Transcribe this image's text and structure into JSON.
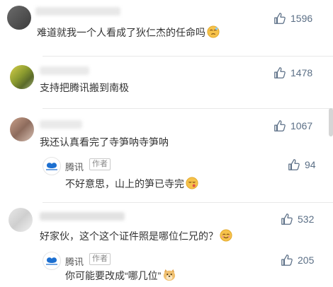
{
  "colors": {
    "like_icon": "#5b6f86",
    "text": "#333333",
    "tencent_blue": "#1c6fd0"
  },
  "comments": [
    {
      "text": "难道就我一个人看成了狄仁杰的任命吗",
      "likes": "1596",
      "emoji": "sleepy-face-icon"
    },
    {
      "text": "支持把腾讯搬到南极",
      "likes": "1478"
    },
    {
      "text": "我还认真看完了寺笋呐寺笋呐",
      "likes": "1067",
      "reply": {
        "author": "腾讯",
        "tag": "作者",
        "text": "不好意思，山上的笋已寺完",
        "likes": "94",
        "emoji": "relieved-face-icon"
      }
    },
    {
      "text": "好家伙，这个这个证件照是哪位仁兄的？",
      "likes": "532",
      "emoji": "smiling-face-icon",
      "reply": {
        "author": "腾讯",
        "tag": "作者",
        "text": "你可能要改成“哪几位”",
        "likes": "205",
        "emoji": "doge-icon"
      }
    }
  ]
}
